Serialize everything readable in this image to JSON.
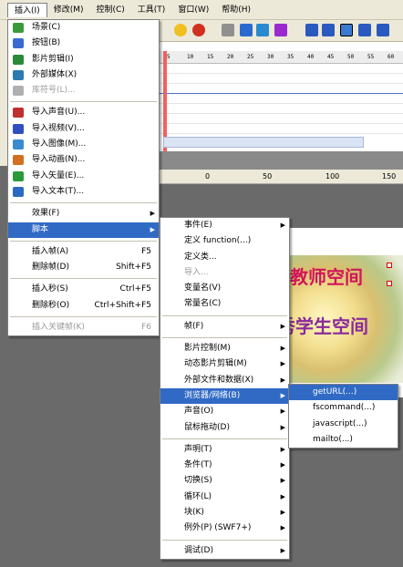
{
  "menubar": [
    {
      "label": "插入(I)",
      "active": true
    },
    {
      "label": "修改(M)"
    },
    {
      "label": "控制(C)"
    },
    {
      "label": "工具(T)"
    },
    {
      "label": "窗口(W)"
    },
    {
      "label": "帮助(H)"
    }
  ],
  "insert_menu": [
    {
      "label": "场景(C)",
      "icon": "scene-icon",
      "color": "#3a9a3a"
    },
    {
      "label": "按钮(B)",
      "icon": "button-icon",
      "color": "#3a6ad0"
    },
    {
      "label": "影片剪辑(I)",
      "icon": "movieclip-icon",
      "color": "#2a8a3a"
    },
    {
      "label": "外部媒体(X)",
      "icon": "external-media-icon",
      "color": "#2a7ab0"
    },
    {
      "label": "库符号(L)...",
      "icon": "library-symbol-icon",
      "color": "#b0b0b0",
      "disabled": true
    },
    {
      "sep": true
    },
    {
      "label": "导入声音(U)...",
      "icon": "sound-icon",
      "color": "#c03030"
    },
    {
      "label": "导入视频(V)...",
      "icon": "video-icon",
      "color": "#3050c0"
    },
    {
      "label": "导入图像(M)...",
      "icon": "image-icon",
      "color": "#3a8ad0"
    },
    {
      "label": "导入动画(N)...",
      "icon": "animation-icon",
      "color": "#d07020"
    },
    {
      "label": "导入矢量(E)...",
      "icon": "vector-icon",
      "color": "#2a9a3a"
    },
    {
      "label": "导入文本(T)...",
      "icon": "text-icon",
      "color": "#2a6ac0"
    },
    {
      "sep": true
    },
    {
      "label": "效果(F)",
      "arrow": true
    },
    {
      "label": "脚本",
      "arrow": true,
      "highlight": true
    },
    {
      "sep": true
    },
    {
      "label": "插入帧(A)",
      "shortcut": "F5"
    },
    {
      "label": "删除帧(D)",
      "shortcut": "Shift+F5"
    },
    {
      "sep": true
    },
    {
      "label": "插入秒(S)",
      "shortcut": "Ctrl+F5"
    },
    {
      "label": "删除秒(O)",
      "shortcut": "Ctrl+Shift+F5"
    },
    {
      "sep": true
    },
    {
      "label": "插入关键帧(K)",
      "shortcut": "F6",
      "disabled": true
    }
  ],
  "script_menu": [
    {
      "label": "事件(E)",
      "arrow": true
    },
    {
      "label": "定义 function(...)"
    },
    {
      "label": "定义类..."
    },
    {
      "label": "导入...",
      "disabled": true
    },
    {
      "label": "变量名(V)"
    },
    {
      "label": "常量名(C)"
    },
    {
      "sep": true
    },
    {
      "label": "帧(F)",
      "arrow": true
    },
    {
      "sep": true
    },
    {
      "label": "影片控制(M)",
      "arrow": true
    },
    {
      "label": "动态影片剪辑(M)",
      "arrow": true
    },
    {
      "label": "外部文件和数据(X)",
      "arrow": true
    },
    {
      "label": "浏览器/网络(B)",
      "arrow": true,
      "highlight": true
    },
    {
      "label": "声音(O)",
      "arrow": true
    },
    {
      "label": "鼠标拖动(D)",
      "arrow": true
    },
    {
      "sep": true
    },
    {
      "label": "声明(T)",
      "arrow": true
    },
    {
      "label": "条件(T)",
      "arrow": true
    },
    {
      "label": "切换(S)",
      "arrow": true
    },
    {
      "label": "循环(L)",
      "arrow": true
    },
    {
      "label": "块(K)",
      "arrow": true
    },
    {
      "label": "例外(P)  (SWF7+)",
      "arrow": true
    },
    {
      "sep": true
    },
    {
      "label": "调试(D)",
      "arrow": true
    }
  ],
  "browser_menu": [
    {
      "label": "getURL(...)",
      "highlight": true
    },
    {
      "label": "fscommand(...)"
    },
    {
      "label": "javascript(...)"
    },
    {
      "label": "mailto(...)"
    }
  ],
  "timeline_ruler": [
    "5",
    "10",
    "15",
    "20",
    "25",
    "30",
    "35",
    "40",
    "45",
    "50",
    "55",
    "60"
  ],
  "stage_ruler": [
    "0",
    "50",
    "100",
    "150"
  ],
  "canvas_text": {
    "line1": "教师空间",
    "line2": "秀学生空间"
  }
}
